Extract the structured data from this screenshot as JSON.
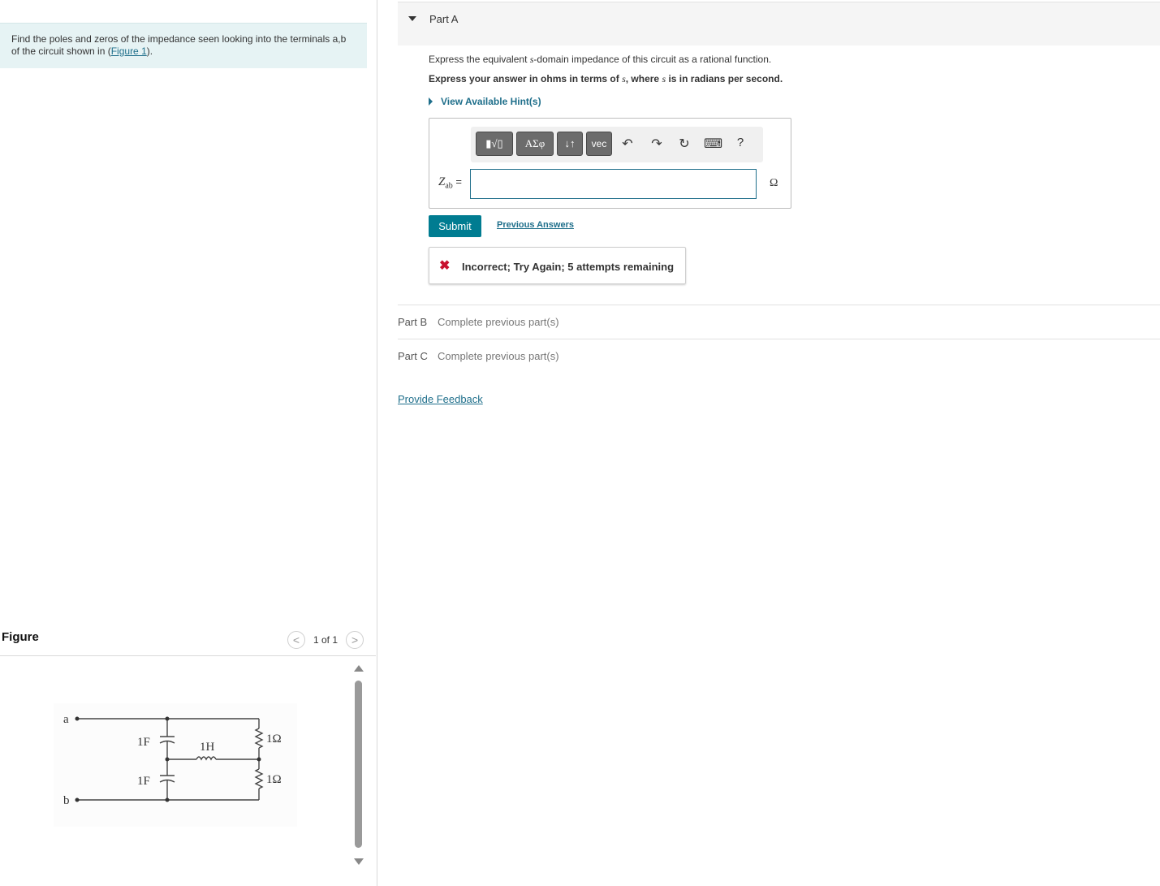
{
  "problem": {
    "text_before_link": "Find the poles and zeros of the impedance seen looking into the terminals a,b of the circuit shown in (",
    "link": "Figure 1",
    "text_after_link": ")."
  },
  "figure": {
    "title": "Figure",
    "counter": "1 of 1",
    "prev_glyph": "<",
    "next_glyph": ">",
    "circuit_labels": {
      "terminal_a": "a",
      "terminal_b": "b",
      "cap_top": "1F",
      "cap_bottom": "1F",
      "inductor": "1H",
      "res_top": "1Ω",
      "res_bottom": "1Ω"
    }
  },
  "part_a": {
    "title": "Part A",
    "instruction_1": {
      "before": "Express the equivalent ",
      "var": "s",
      "after": "-domain impedance of this circuit as a rational function."
    },
    "instruction_2": {
      "before": "Express your answer in ohms in terms of ",
      "var1": "s",
      "middle": ", where ",
      "var2": "s",
      "after": " is in radians per second."
    },
    "hints_label": "View Available Hint(s)",
    "toolbar": {
      "templates_label": "▮√▯",
      "greek_label": "ΑΣφ",
      "arrows_label": "↓↑",
      "vec_label": "vec",
      "undo_icon": "↶",
      "redo_icon": "↷",
      "reset_icon": "↻",
      "keyboard_icon": "⌨",
      "help_label": "?"
    },
    "answer_label_var": "Z",
    "answer_label_sub": "ab",
    "answer_label_eq": " =",
    "answer_value": "",
    "unit": "Ω",
    "submit_label": "Submit",
    "previous_answers_label": "Previous Answers",
    "feedback": {
      "icon": "✖",
      "text": "Incorrect; Try Again; 5 attempts remaining"
    }
  },
  "other_parts": [
    {
      "name": "Part B",
      "status": "Complete previous part(s)"
    },
    {
      "name": "Part C",
      "status": "Complete previous part(s)"
    }
  ],
  "provide_feedback_label": "Provide Feedback",
  "colors": {
    "accent": "#007c91",
    "link": "#1f6f8b",
    "problem_bg": "#e6f3f4",
    "error": "#c8102e"
  }
}
